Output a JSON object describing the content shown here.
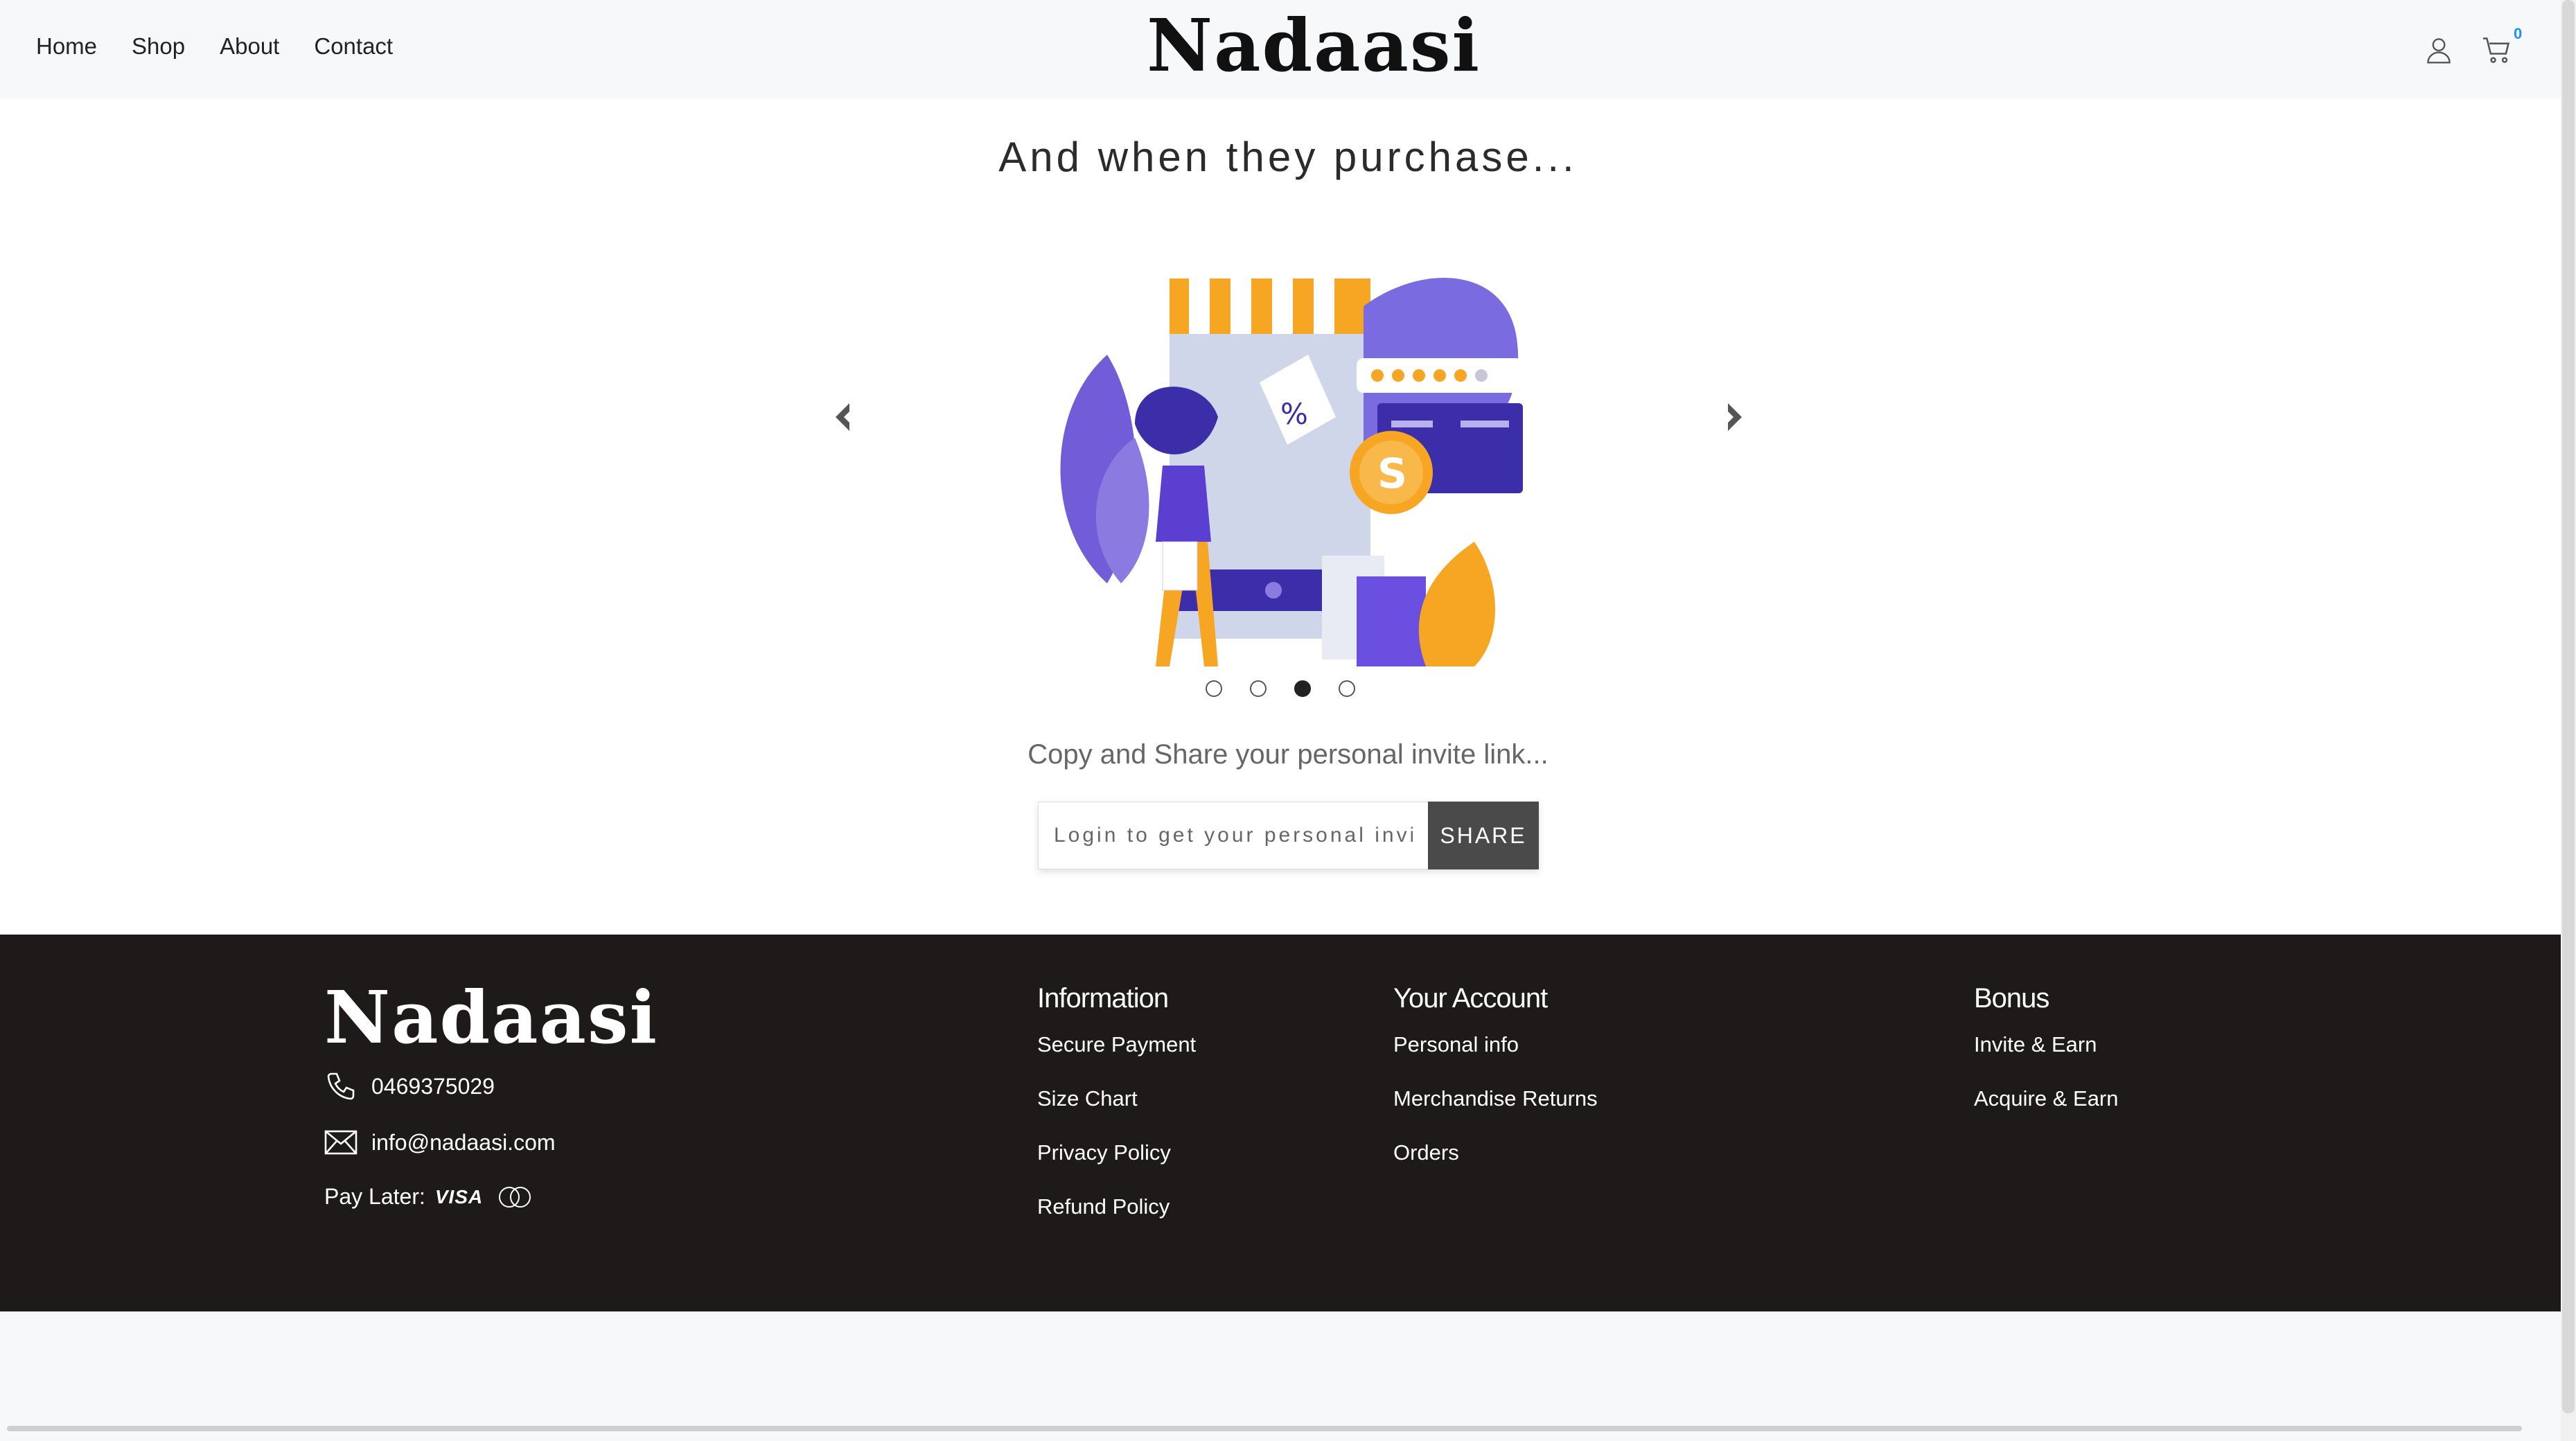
{
  "header": {
    "nav": [
      "Home",
      "Shop",
      "About",
      "Contact"
    ],
    "logo": "Nadaasi",
    "cart_count": "0"
  },
  "main": {
    "heading": "And when they purchase...",
    "subheading": "Copy and Share your personal invite link...",
    "invite_placeholder": "Login to get your personal invite link",
    "share_label": "SHARE",
    "carousel_active_index": 2,
    "carousel_total": 4
  },
  "footer": {
    "logo": "Nadaasi",
    "phone": "0469375029",
    "email": "info@nadaasi.com",
    "pay_later_label": "Pay Later:",
    "visa_label": "VISA",
    "columns": [
      {
        "title": "Information",
        "links": [
          "Secure Payment",
          "Size Chart",
          "Privacy Policy",
          "Refund Policy"
        ]
      },
      {
        "title": "Your Account",
        "links": [
          "Personal info",
          "Merchandise Returns",
          "Orders"
        ]
      },
      {
        "title": "Bonus",
        "links": [
          "Invite & Earn",
          "Acquire & Earn"
        ]
      }
    ]
  },
  "colors": {
    "footer_bg": "#1f1a1a",
    "share_bg": "#4a4a4a",
    "accent_orange": "#f6a623",
    "accent_purple": "#5a3fd0"
  }
}
